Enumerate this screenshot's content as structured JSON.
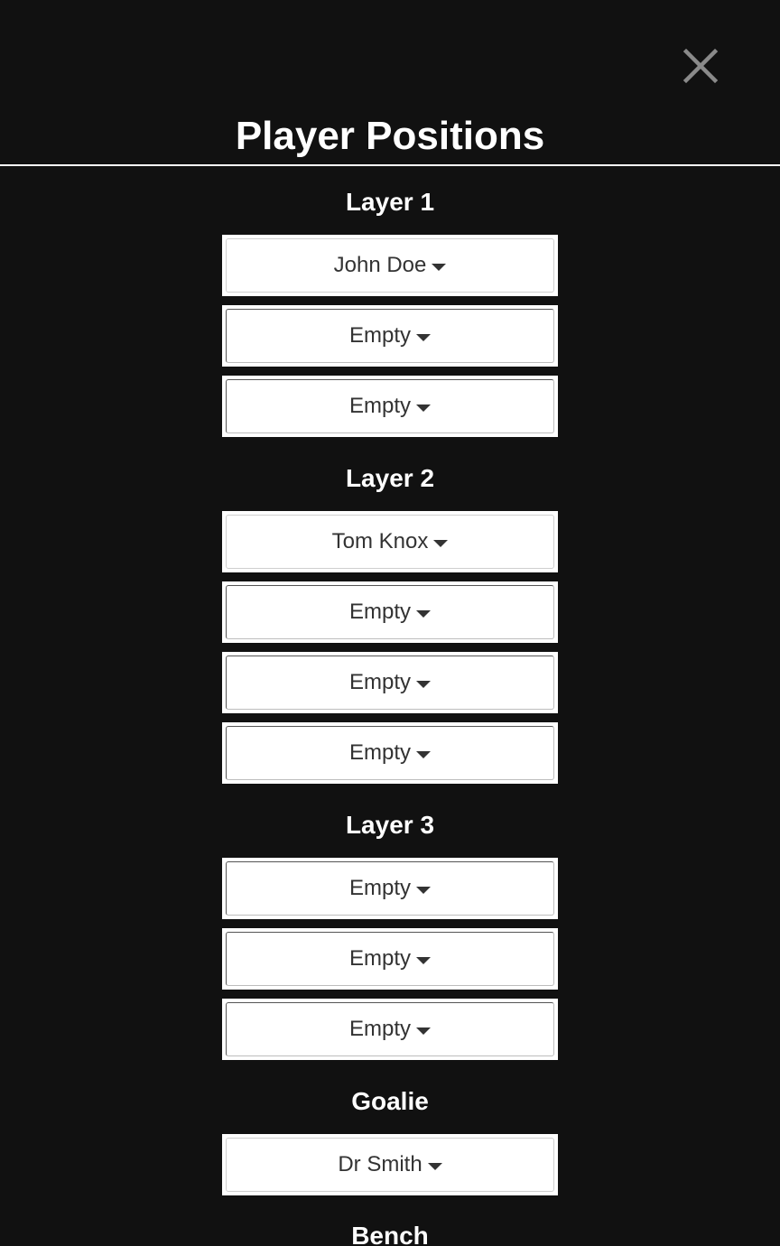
{
  "modal": {
    "title": "Player Positions",
    "close_icon": "close-icon"
  },
  "sections": [
    {
      "heading": "Layer 1",
      "slots": [
        "John Doe",
        "Empty",
        "Empty"
      ]
    },
    {
      "heading": "Layer 2",
      "slots": [
        "Tom Knox",
        "Empty",
        "Empty",
        "Empty"
      ]
    },
    {
      "heading": "Layer 3",
      "slots": [
        "Empty",
        "Empty",
        "Empty"
      ]
    },
    {
      "heading": "Goalie",
      "slots": [
        "Dr Smith"
      ]
    },
    {
      "heading": "Bench",
      "slots": []
    }
  ],
  "colors": {
    "background": "#111111",
    "text": "#ffffff",
    "dropdown_text": "#333333",
    "close_icon": "#8a8a8a"
  }
}
